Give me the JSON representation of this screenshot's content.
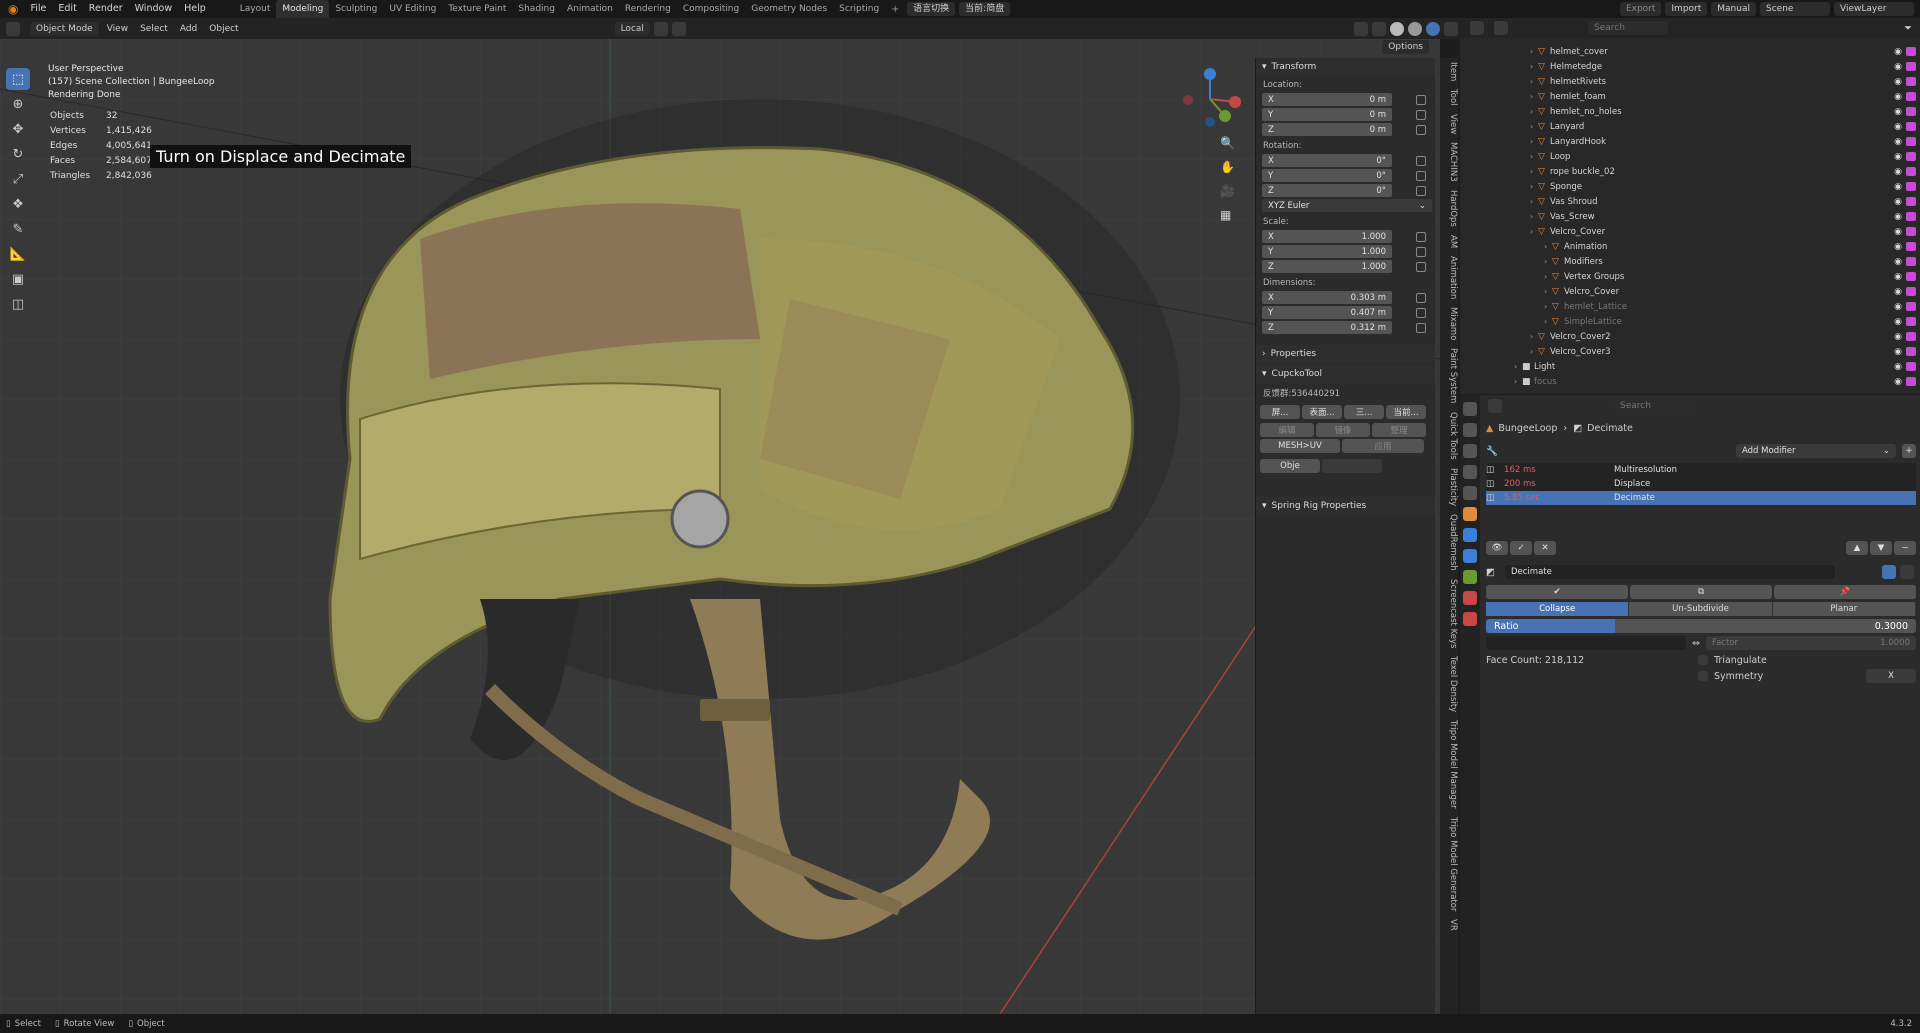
{
  "topbar": {
    "menus": [
      "File",
      "Edit",
      "Render",
      "Window",
      "Help"
    ],
    "workspaces": [
      "Layout",
      "Modeling",
      "Sculpting",
      "UV Editing",
      "Texture Paint",
      "Shading",
      "Animation",
      "Rendering",
      "Compositing",
      "Geometry Nodes",
      "Scripting"
    ],
    "active_workspace": "Modeling",
    "plugin_buttons": [
      "语言切换",
      "当前:简盘"
    ],
    "export": "Export",
    "import": "Import",
    "manual": "Manual",
    "scene": "Scene",
    "viewlayer": "ViewLayer"
  },
  "header": {
    "mode": "Object Mode",
    "menus": [
      "View",
      "Select",
      "Add",
      "Object"
    ],
    "orientation": "Local",
    "options": "Options"
  },
  "viewport": {
    "perspective": "User Perspective",
    "collection": "(157) Scene Collection | BungeeLoop",
    "render_status": "Rendering Done",
    "stats": [
      {
        "label": "Objects",
        "value": "32"
      },
      {
        "label": "Vertices",
        "value": "1,415,426"
      },
      {
        "label": "Edges",
        "value": "4,005,641"
      },
      {
        "label": "Faces",
        "value": "2,584,607"
      },
      {
        "label": "Triangles",
        "value": "2,842,036"
      }
    ],
    "caption": "Turn on Displace and Decimate"
  },
  "npanel": {
    "transform": "Transform",
    "location_label": "Location:",
    "location": [
      {
        "axis": "X",
        "value": "0 m"
      },
      {
        "axis": "Y",
        "value": "0 m"
      },
      {
        "axis": "Z",
        "value": "0 m"
      }
    ],
    "rotation_label": "Rotation:",
    "rotation": [
      {
        "axis": "X",
        "value": "0°"
      },
      {
        "axis": "Y",
        "value": "0°"
      },
      {
        "axis": "Z",
        "value": "0°"
      }
    ],
    "rotation_mode": "XYZ Euler",
    "scale_label": "Scale:",
    "scale": [
      {
        "axis": "X",
        "value": "1.000"
      },
      {
        "axis": "Y",
        "value": "1.000"
      },
      {
        "axis": "Z",
        "value": "1.000"
      }
    ],
    "dimensions_label": "Dimensions:",
    "dimensions": [
      {
        "axis": "X",
        "value": "0.303 m"
      },
      {
        "axis": "Y",
        "value": "0.407 m"
      },
      {
        "axis": "Z",
        "value": "0.312 m"
      }
    ],
    "properties": "Properties",
    "cupcko": "CupckoTool",
    "cupcko_id": "反馈群:536440291",
    "cupcko_btns": [
      "屏...",
      "表面...",
      "三...",
      "当前..."
    ],
    "cupcko_row2": [
      "编辑",
      "镜像",
      "整理"
    ],
    "mesh_uv": "MESH>UV",
    "apply": "应用",
    "obje": "Obje",
    "spring": "Spring Rig Properties"
  },
  "vtabs": [
    "Item",
    "Tool",
    "View",
    "MACHIN3",
    "HardOps",
    "AM",
    "Animation",
    "Mixamo",
    "Paint System",
    "Quick Tools",
    "Plasticity",
    "QuadRemesh",
    "Screencast Keys",
    "Texel Density",
    "Tripo Model Manager",
    "Tripo Model Generator",
    "VR"
  ],
  "outliner": {
    "search": "Search",
    "items": [
      {
        "name": "helmet_cover",
        "indent": 0,
        "dim": false
      },
      {
        "name": "Helmetedge",
        "indent": 0,
        "dim": false
      },
      {
        "name": "helmetRivets",
        "indent": 0,
        "dim": false
      },
      {
        "name": "hemlet_foam",
        "indent": 0,
        "dim": false
      },
      {
        "name": "hemlet_no_holes",
        "indent": 0,
        "dim": false
      },
      {
        "name": "Lanyard",
        "indent": 0,
        "dim": false
      },
      {
        "name": "LanyardHook",
        "indent": 0,
        "dim": false
      },
      {
        "name": "Loop",
        "indent": 0,
        "dim": false
      },
      {
        "name": "rope buckle_02",
        "indent": 0,
        "dim": false
      },
      {
        "name": "Sponge",
        "indent": 0,
        "dim": false
      },
      {
        "name": "Vas Shroud",
        "indent": 0,
        "dim": false
      },
      {
        "name": "Vas_Screw",
        "indent": 0,
        "dim": false
      },
      {
        "name": "Velcro_Cover",
        "indent": 0,
        "dim": false
      },
      {
        "name": "Animation",
        "indent": 1,
        "dim": false
      },
      {
        "name": "Modifiers",
        "indent": 1,
        "dim": false
      },
      {
        "name": "Vertex Groups",
        "indent": 1,
        "dim": false
      },
      {
        "name": "Velcro_Cover",
        "indent": 1,
        "dim": false
      },
      {
        "name": "hemlet_Lattice",
        "indent": 1,
        "dim": true
      },
      {
        "name": "SimpleLattice",
        "indent": 1,
        "dim": true
      },
      {
        "name": "Velcro_Cover2",
        "indent": 0,
        "dim": false
      },
      {
        "name": "Velcro_Cover3",
        "indent": 0,
        "dim": false
      },
      {
        "name": "Light",
        "indent": -1,
        "dim": false
      },
      {
        "name": "focus",
        "indent": -1,
        "dim": true
      }
    ]
  },
  "props": {
    "search": "Search",
    "breadcrumb_obj": "BungeeLoop",
    "breadcrumb_mod": "Decimate",
    "add_modifier": "Add Modifier",
    "modifiers": [
      {
        "time": "162 ms",
        "name": "Multiresolution",
        "sel": false
      },
      {
        "time": "200 ms",
        "name": "Displace",
        "sel": false
      },
      {
        "time": "5.85 sec",
        "name": "Decimate",
        "sel": true
      }
    ],
    "mod_name": "Decimate",
    "modes": [
      "Collapse",
      "Un-Subdivide",
      "Planar"
    ],
    "active_mode": "Collapse",
    "ratio_label": "Ratio",
    "ratio": "0.3000",
    "ratio_fraction": 0.3,
    "factor_label": "Factor",
    "factor": "1.0000",
    "triangulate": "Triangulate",
    "symmetry": "Symmetry",
    "sym_axis": "X",
    "face_count": "Face Count: 218,112"
  },
  "status": {
    "select": "Select",
    "rotate": "Rotate View",
    "object": "Object",
    "version": "4.3.2"
  }
}
